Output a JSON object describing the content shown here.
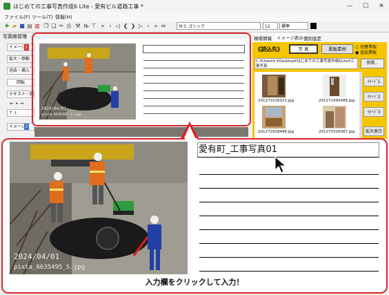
{
  "window": {
    "title": "はじめての工事写真作成6 Lite - 愛有ビル道路工事 *",
    "minimize": "—",
    "maximize": "☐",
    "close": "✕"
  },
  "menu": [
    "ファイル(F)",
    "ツール(T)",
    "情報(H)"
  ],
  "toolbar": {
    "font_name": "ＭＳ ゴシック",
    "font_size": "12",
    "style": "標準"
  },
  "left_panel": {
    "header": "写真帳管理",
    "image1": "イメージ",
    "image1_badge": "1",
    "expand_move": "拡大・移動",
    "delete_insert": "消去・挿入",
    "rotate": "回転",
    "text_label": "テキスト・図",
    "arrows": "↑ ↓",
    "image2": "イメージ",
    "image2_badge": "2"
  },
  "mini_photo": {
    "date": "2024/04/01",
    "watermark": "pixta_6635495_S.jpg"
  },
  "right_panel": {
    "tab_field": "現場情報",
    "tab_image": "イメージ表示",
    "tab_individual": "個別設定",
    "load_label": "《読込先》",
    "photo_btn": "写 真",
    "board_btn": "黒板素材",
    "radio_switch": "切替黒板",
    "radio_add": "追加黒板",
    "path": "C:¥Users¥      ¥Desktop¥はじめての工事写真作成6Lite¥工事写真",
    "browse": "参照...",
    "thumbs": [
      "201271016021.jpg",
      "201271990488.jpg",
      "201272928496.jpg",
      "201273316087.jpg"
    ],
    "img_btn1": "ｲﾒｰｼﾞ1",
    "img_btn2": "ｲﾒｰｼﾞ2",
    "img_btn3": "ｲﾒｰｼﾞ3",
    "zoom_btn": "拡大表示"
  },
  "zoom": {
    "input_text": "愛有町_工事写真01",
    "photo_date": "2024/04/01",
    "photo_watermark": "pixta_6635495_S.jpg"
  },
  "caption": "入力欄をクリックして入力！",
  "colors": {
    "accent_red": "#d8252b",
    "panel_yellow": "#f5c500"
  }
}
